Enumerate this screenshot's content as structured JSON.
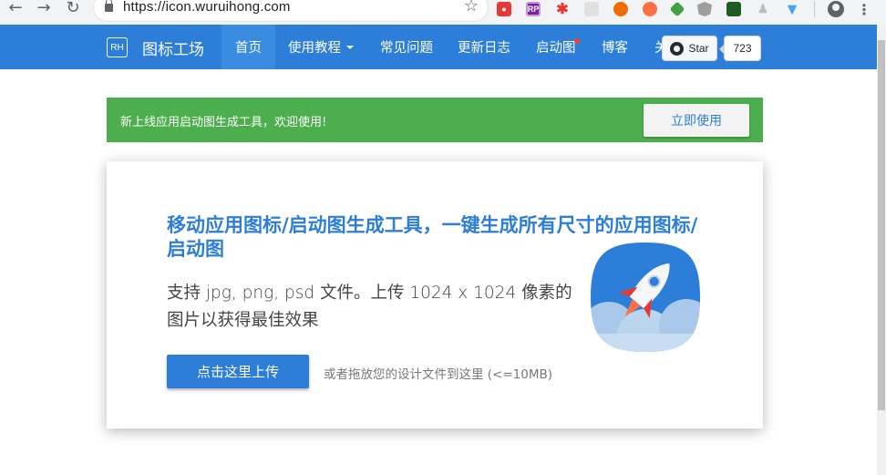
{
  "browser": {
    "url": "https://icon.wuruihong.com"
  },
  "navbar": {
    "logo_text": "RH",
    "brand": "图标工场",
    "items": [
      {
        "label": "首页"
      },
      {
        "label": "使用教程"
      },
      {
        "label": "常见问题"
      },
      {
        "label": "更新日志"
      },
      {
        "label": "启动图"
      },
      {
        "label": "博客"
      },
      {
        "label": "关"
      }
    ],
    "github": {
      "star_label": "Star",
      "star_count": "723"
    }
  },
  "banner": {
    "text": "新上线应用启动图生成工具，欢迎使用!",
    "button": "立即使用"
  },
  "hero": {
    "title": "移动应用图标/启动图生成工具，一键生成所有尺寸的应用图标/启动图",
    "subtitle": "支持 jpg, png, psd 文件。上传 1024 x 1024 像素的图片以获得最佳效果",
    "upload_button": "点击这里上传",
    "upload_hint": "或者拖放您的设计文件到这里 (<=10MB)"
  },
  "colors": {
    "primary": "#2d7ed9",
    "success": "#4cae4c",
    "notification": "#ff3b30"
  }
}
